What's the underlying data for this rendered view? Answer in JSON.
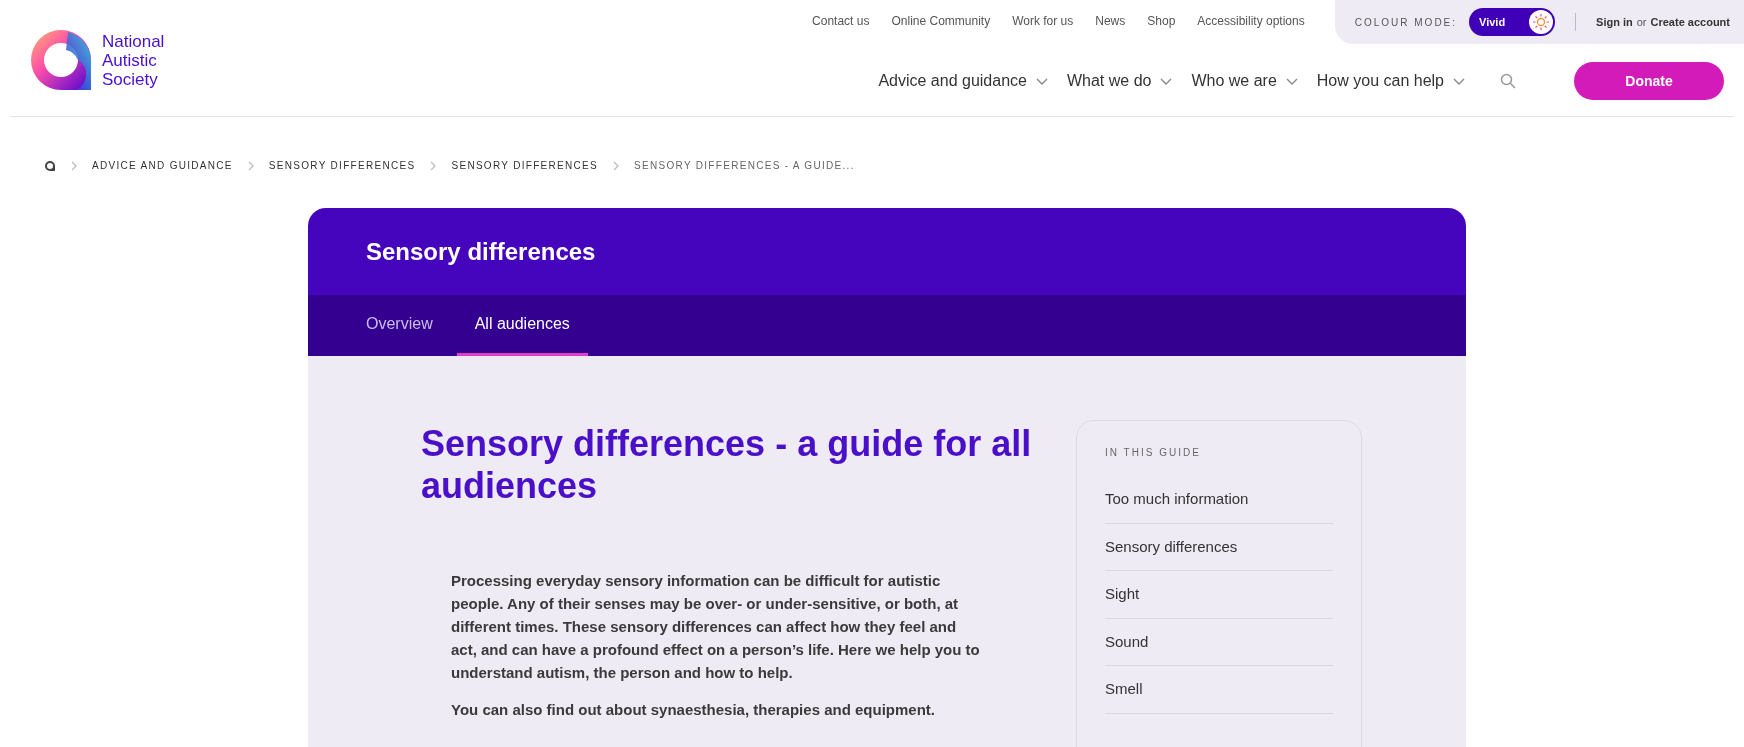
{
  "header": {
    "logo_text": "National Autistic Society",
    "top_links": [
      "Contact us",
      "Online Community",
      "Work for us",
      "News",
      "Shop",
      "Accessibility options"
    ],
    "colour_mode": {
      "label": "COLOUR MODE:",
      "switch_label": "Vivid",
      "on": true
    },
    "account": {
      "sign_in": "Sign in",
      "or": "or",
      "create": "Create account"
    },
    "nav": [
      "Advice and guidance",
      "What we do",
      "Who we are",
      "How you can help"
    ],
    "donate": "Donate"
  },
  "breadcrumb": [
    "ADVICE AND GUIDANCE",
    "SENSORY DIFFERENCES",
    "SENSORY DIFFERENCES",
    "SENSORY DIFFERENCES - A GUIDE..."
  ],
  "section": {
    "title": "Sensory differences",
    "tabs": [
      {
        "label": "Overview",
        "selected": false
      },
      {
        "label": "All audiences",
        "selected": true
      }
    ]
  },
  "article": {
    "title": "Sensory differences - a guide for all audiences",
    "paragraphs": [
      "Processing everyday sensory information can be difficult for autistic people. Any of their senses may be over- or under-sensitive, or both, at different times. These sensory differences can affect how they feel and act, and can have a profound effect on a person’s life. Here we help you to understand autism, the person and how to help.",
      "You can also find out about synaesthesia, therapies and equipment."
    ]
  },
  "guide": {
    "heading": "IN THIS GUIDE",
    "items": [
      "Too much information",
      "Sensory differences",
      "Sight",
      "Sound",
      "Smell"
    ]
  }
}
